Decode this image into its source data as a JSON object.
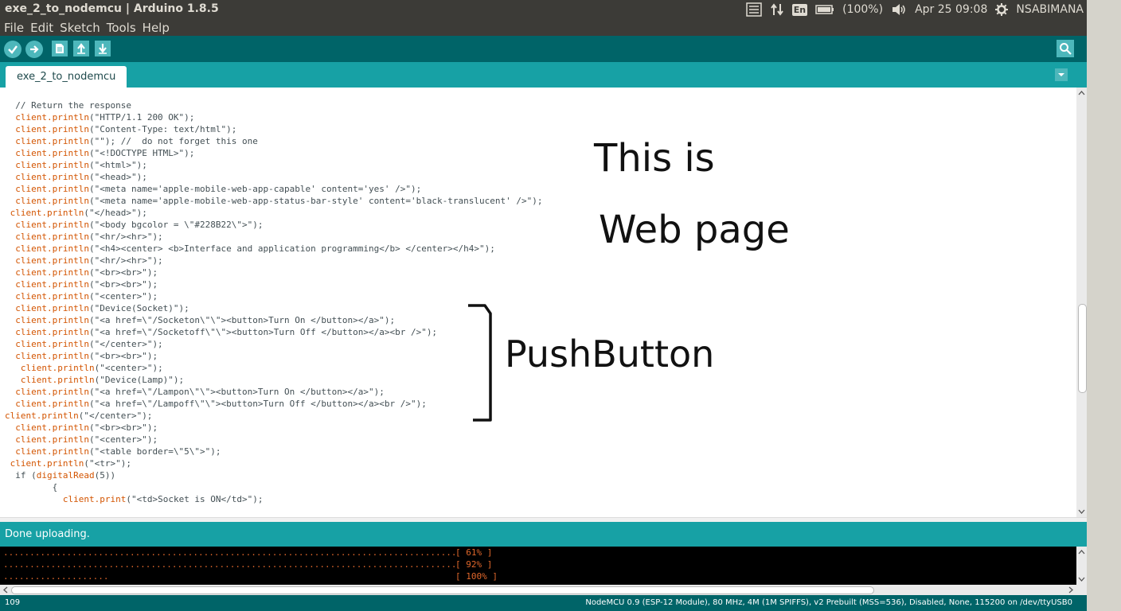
{
  "window": {
    "title": "exe_2_to_nodemcu | Arduino 1.8.5"
  },
  "tray": {
    "keyboard": "En",
    "battery": "(100%)",
    "datetime": "Apr 25 09:08",
    "user": "NSABIMANA"
  },
  "menu": {
    "items": [
      "File",
      "Edit",
      "Sketch",
      "Tools",
      "Help"
    ]
  },
  "tab": {
    "label": "exe_2_to_nodemcu"
  },
  "code": {
    "lines": [
      {
        "indent": "  ",
        "fn": "",
        "text": "// Return the response"
      },
      {
        "indent": "  ",
        "fn": "client.println",
        "text": "(\"HTTP/1.1 200 OK\");"
      },
      {
        "indent": "  ",
        "fn": "client.println",
        "text": "(\"Content-Type: text/html\");"
      },
      {
        "indent": "  ",
        "fn": "client.println",
        "text": "(\"\"); //  do not forget this one"
      },
      {
        "indent": "  ",
        "fn": "client.println",
        "text": "(\"<!DOCTYPE HTML>\");"
      },
      {
        "indent": "  ",
        "fn": "client.println",
        "text": "(\"<html>\");"
      },
      {
        "indent": "  ",
        "fn": "client.println",
        "text": "(\"<head>\");"
      },
      {
        "indent": "  ",
        "fn": "client.println",
        "text": "(\"<meta name='apple-mobile-web-app-capable' content='yes' />\");"
      },
      {
        "indent": "  ",
        "fn": "client.println",
        "text": "(\"<meta name='apple-mobile-web-app-status-bar-style' content='black-translucent' />\");"
      },
      {
        "indent": " ",
        "fn": "client.println",
        "text": "(\"</head>\");"
      },
      {
        "indent": "  ",
        "fn": "client.println",
        "text": "(\"<body bgcolor = \\\"#228B22\\\">\");"
      },
      {
        "indent": "  ",
        "fn": "client.println",
        "text": "(\"<hr/><hr>\");"
      },
      {
        "indent": "  ",
        "fn": "client.println",
        "text": "(\"<h4><center> <b>Interface and application programming</b> </center></h4>\");"
      },
      {
        "indent": "  ",
        "fn": "client.println",
        "text": "(\"<hr/><hr>\");"
      },
      {
        "indent": "  ",
        "fn": "client.println",
        "text": "(\"<br><br>\");"
      },
      {
        "indent": "  ",
        "fn": "client.println",
        "text": "(\"<br><br>\");"
      },
      {
        "indent": "  ",
        "fn": "client.println",
        "text": "(\"<center>\");"
      },
      {
        "indent": "  ",
        "fn": "client.println",
        "text": "(\"Device(Socket)\");"
      },
      {
        "indent": "  ",
        "fn": "client.println",
        "text": "(\"<a href=\\\"/Socketon\\\"\\\"><button>Turn On </button></a>\");"
      },
      {
        "indent": "  ",
        "fn": "client.println",
        "text": "(\"<a href=\\\"/Socketoff\\\"\\\"><button>Turn Off </button></a><br />\");"
      },
      {
        "indent": "  ",
        "fn": "client.println",
        "text": "(\"</center>\");"
      },
      {
        "indent": "  ",
        "fn": "client.println",
        "text": "(\"<br><br>\");"
      },
      {
        "indent": "   ",
        "fn": "client.println",
        "text": "(\"<center>\");"
      },
      {
        "indent": "   ",
        "fn": "client.println",
        "text": "(\"Device(Lamp)\");"
      },
      {
        "indent": "  ",
        "fn": "client.println",
        "text": "(\"<a href=\\\"/Lampon\\\"\\\"><button>Turn On </button></a>\");"
      },
      {
        "indent": "  ",
        "fn": "client.println",
        "text": "(\"<a href=\\\"/Lampoff\\\"\\\"><button>Turn Off </button></a><br />\");"
      },
      {
        "indent": "",
        "fn": "client.println",
        "text": "(\"</center>\");"
      },
      {
        "indent": "  ",
        "fn": "client.println",
        "text": "(\"<br><br>\");"
      },
      {
        "indent": "  ",
        "fn": "client.println",
        "text": "(\"<center>\");"
      },
      {
        "indent": "  ",
        "fn": "client.println",
        "text": "(\"<table border=\\\"5\\\">\");"
      },
      {
        "indent": " ",
        "fn": "client.println",
        "text": "(\"<tr>\");"
      },
      {
        "indent": "  ",
        "fn": "",
        "text": "if (",
        "fn2": "digitalRead",
        "text2": "(5))"
      },
      {
        "indent": "         ",
        "fn": "",
        "text": "{"
      },
      {
        "indent": "           ",
        "fn": "client.print",
        "text": "(\"<td>Socket is ON</td>\");"
      }
    ]
  },
  "annotations": {
    "line1": "This is",
    "line2": "Web page",
    "bracket_label": "PushButton"
  },
  "status": {
    "text": "Done uploading."
  },
  "console": {
    "lines": [
      {
        "dots": "......................................................................................",
        "pct": "[ 61% ]"
      },
      {
        "dots": "......................................................................................",
        "pct": "[ 92% ]"
      },
      {
        "dots": "....................",
        "pct": "[ 100% ]"
      }
    ]
  },
  "footer": {
    "line_number": "109",
    "board": "NodeMCU 0.9 (ESP-12 Module), 80 MHz, 4M (1M SPIFFS), v2 Prebuilt (MSS=536), Disabled, None, 115200 on /dev/ttyUSB0"
  },
  "colors": {
    "toolbar": "#006468",
    "tabbar": "#17a1a5",
    "keyword": "#d35400",
    "console_text": "#e0672b"
  }
}
